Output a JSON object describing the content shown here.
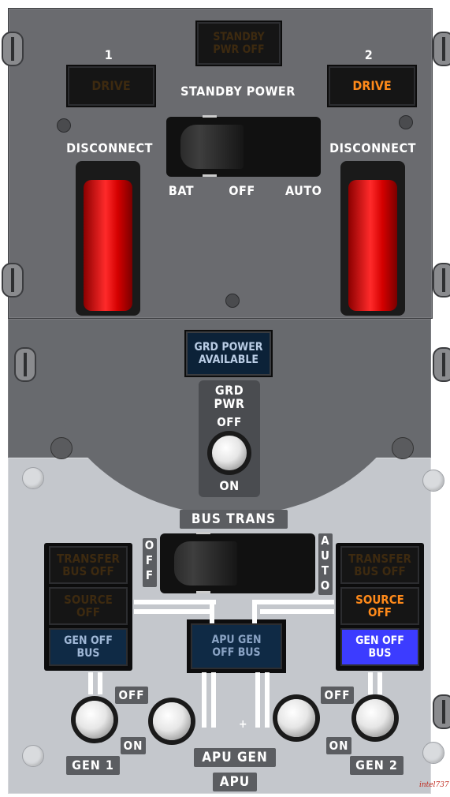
{
  "standby": {
    "standby_pwr_off": "STANDBY\nPWR OFF",
    "drive1_num": "1",
    "drive2_num": "2",
    "drive_label": "DRIVE",
    "standby_power_title": "STANDBY POWER",
    "disconnect_label": "DISCONNECT",
    "positions": [
      "BAT",
      "OFF",
      "AUTO"
    ]
  },
  "ground": {
    "grd_power_available": "GRD POWER\nAVAILABLE",
    "grd_pwr": "GRD\nPWR",
    "off": "OFF",
    "on": "ON"
  },
  "bus": {
    "bus_trans": "BUS TRANS",
    "off_vertical": "OFF",
    "auto_vertical": "AUTO",
    "transfer_bus_off": "TRANSFER\nBUS OFF",
    "source_off": "SOURCE\nOFF",
    "gen_off_bus": "GEN OFF\nBUS",
    "apu_gen_off_bus": "APU GEN\nOFF BUS",
    "off": "OFF",
    "on": "ON",
    "gen1": "GEN 1",
    "gen2": "GEN 2",
    "apu_gen": "APU GEN",
    "apu": "APU",
    "plus": "+",
    "signature": "intel737"
  },
  "colors": {
    "amber": "#ff8a1a",
    "blue_on": "#3c3cff",
    "guard_red": "#ff2a2a",
    "panel_dark": "#686a6e",
    "panel_light": "#c4c7cc"
  }
}
